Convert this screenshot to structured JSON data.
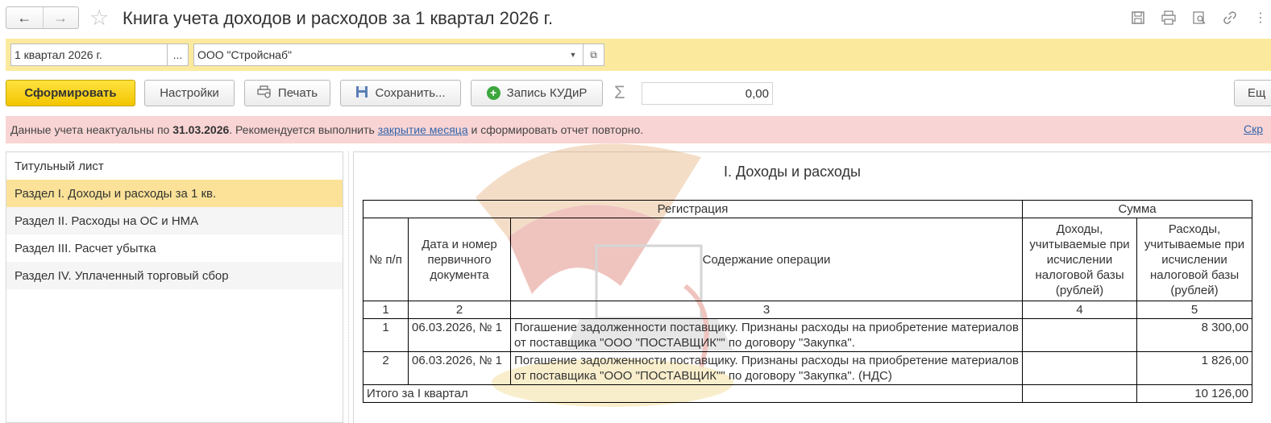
{
  "window": {
    "title": "Книга учета доходов и расходов за 1 квартал 2026 г."
  },
  "params": {
    "period": "1 квартал 2026 г.",
    "period_select": "...",
    "organization": "ООО \"Стройснаб\""
  },
  "toolbar": {
    "generate": "Сформировать",
    "settings": "Настройки",
    "print": "Печать",
    "save": "Сохранить...",
    "record": "Запись КУДиР",
    "sigma": "Σ",
    "sum": "0,00",
    "more": "Ещ"
  },
  "warning": {
    "text_before": "Данные учета неактуальны по ",
    "date": "31.03.2026",
    "text_middle": ". Рекомендуется выполнить ",
    "link": "закрытие месяца",
    "text_after": " и сформировать отчет повторно.",
    "hide_link": "Скр"
  },
  "sidebar": {
    "items": [
      {
        "label": "Титульный лист"
      },
      {
        "label": "Раздел I. Доходы и расходы за 1 кв."
      },
      {
        "label": "Раздел II. Расходы на ОС и НМА"
      },
      {
        "label": "Раздел III. Расчет убытка"
      },
      {
        "label": "Раздел IV. Уплаченный торговый сбор"
      }
    ],
    "selected_index": 1
  },
  "report": {
    "title": "I. Доходы и расходы",
    "headers": {
      "registration": "Регистрация",
      "sum": "Сумма",
      "num": "№ п/п",
      "date_doc": "Дата и номер первичного документа",
      "content": "Содержание операции",
      "income": "Доходы, учитываемые при исчислении налоговой базы (рублей)",
      "expense": "Расходы, учитываемые при исчислении налоговой базы (рублей)"
    },
    "col_numbers": [
      "1",
      "2",
      "3",
      "4",
      "5"
    ],
    "rows": [
      {
        "num": "1",
        "date": "06.03.2026, № 1",
        "content": "Погашение задолженности поставщику. Признаны расходы на приобретение материалов от поставщика \"ООО \"ПОСТАВЩИК\"\" по договору \"Закупка\".",
        "income": "",
        "expense": "8 300,00"
      },
      {
        "num": "2",
        "date": "06.03.2026, № 1",
        "content": "Погашение задолженности поставщику. Признаны расходы на приобретение материалов от поставщика \"ООО \"ПОСТАВЩИК\"\" по договору \"Закупка\". (НДС)",
        "income": "",
        "expense": "1 826,00"
      }
    ],
    "total_label": "Итого за I квартал",
    "total_income": "",
    "total_expense": "10 126,00"
  }
}
